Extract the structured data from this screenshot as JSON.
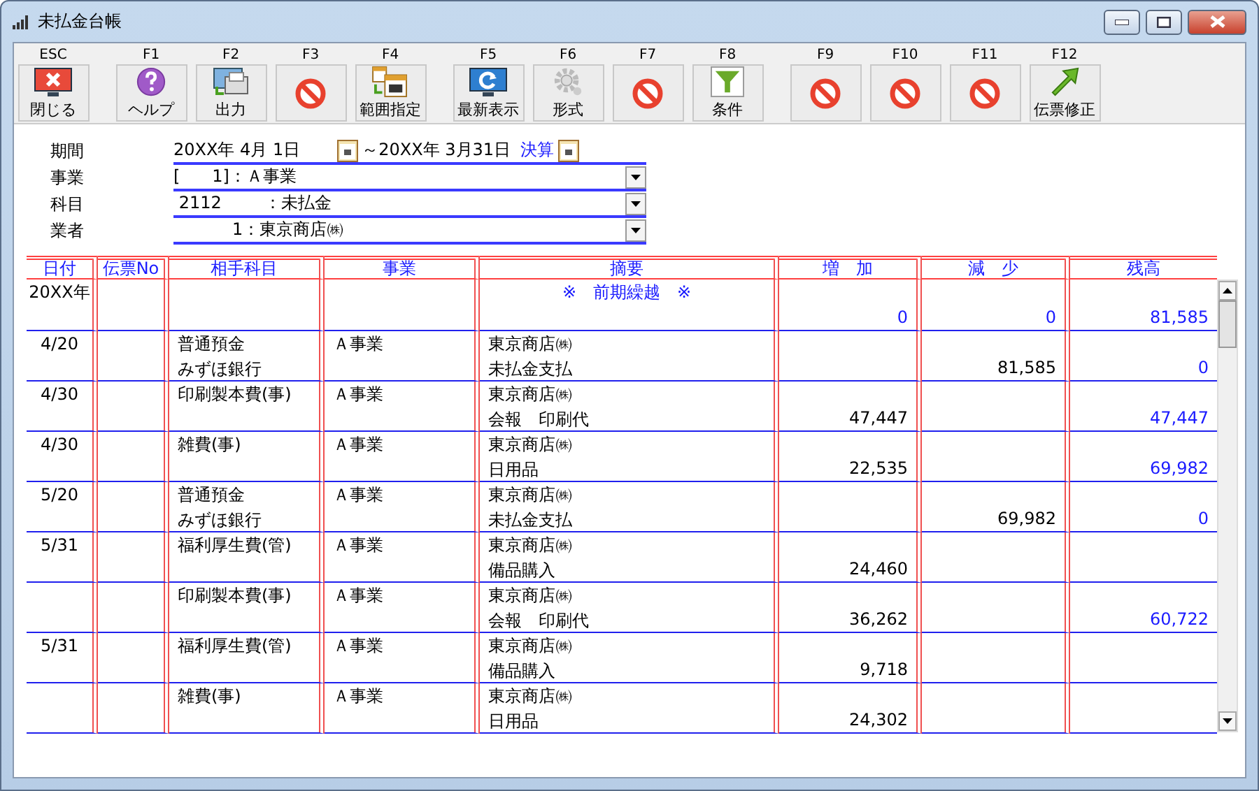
{
  "window": {
    "title": "未払金台帳"
  },
  "toolbar": [
    [
      {
        "key": "ESC",
        "kind": "close",
        "label": "閉じる"
      }
    ],
    [
      {
        "key": "F1",
        "kind": "help",
        "label": "ヘルプ"
      },
      {
        "key": "F2",
        "kind": "output",
        "label": "出力"
      },
      {
        "key": "F3",
        "kind": "none"
      },
      {
        "key": "F4",
        "kind": "calendar",
        "label": "範囲指定"
      }
    ],
    [
      {
        "key": "F5",
        "kind": "refresh",
        "label": "最新表示"
      },
      {
        "key": "F6",
        "kind": "gear",
        "label": "形式"
      },
      {
        "key": "F7",
        "kind": "none"
      },
      {
        "key": "F8",
        "kind": "filter",
        "label": "条件"
      }
    ],
    [
      {
        "key": "F9",
        "kind": "none"
      },
      {
        "key": "F10",
        "kind": "none"
      },
      {
        "key": "F11",
        "kind": "none"
      },
      {
        "key": "F12",
        "kind": "arrow",
        "label": "伝票修正"
      }
    ]
  ],
  "period": {
    "label": "期間",
    "from": "20XX年 4月 1日",
    "to": "～20XX年 3月31日",
    "link": "決算"
  },
  "fields": [
    {
      "label": "事業",
      "value": "[      1]：Ａ事業"
    },
    {
      "label": "科目",
      "value": " 2112        ：未払金"
    },
    {
      "label": "業者",
      "value": "           1：東京商店㈱"
    }
  ],
  "table": {
    "columns": [
      "日付",
      "伝票No",
      "相手科目",
      "事業",
      "摘要",
      "増　加",
      "減　少",
      "残高"
    ],
    "rows": [
      {
        "kind": "carry",
        "date": "20XX年",
        "memo": [
          "※　前期繰越　※"
        ],
        "increase": "0",
        "decrease": "0",
        "balance": "81,585"
      },
      {
        "kind": "entry",
        "date": "4/20",
        "account": [
          "普通預金",
          "みずほ銀行"
        ],
        "business": "Ａ事業",
        "memo": [
          "東京商店㈱",
          "未払金支払"
        ],
        "decrease": "81,585",
        "balance": "0"
      },
      {
        "kind": "entry",
        "date": "4/30",
        "account": [
          "印刷製本費(事)"
        ],
        "business": "Ａ事業",
        "memo": [
          "東京商店㈱",
          "会報　印刷代"
        ],
        "increase": "47,447",
        "balance": "47,447"
      },
      {
        "kind": "entry",
        "date": "4/30",
        "account": [
          "雑費(事)"
        ],
        "business": "Ａ事業",
        "memo": [
          "東京商店㈱",
          "日用品"
        ],
        "increase": "22,535",
        "balance": "69,982"
      },
      {
        "kind": "entry",
        "date": "5/20",
        "account": [
          "普通預金",
          "みずほ銀行"
        ],
        "business": "Ａ事業",
        "memo": [
          "東京商店㈱",
          "未払金支払"
        ],
        "decrease": "69,982",
        "balance": "0"
      },
      {
        "kind": "entry",
        "date": "5/31",
        "account": [
          "福利厚生費(管)"
        ],
        "business": "Ａ事業",
        "memo": [
          "東京商店㈱",
          "備品購入"
        ],
        "increase": "24,460"
      },
      {
        "kind": "entry",
        "account": [
          "印刷製本費(事)"
        ],
        "business": "Ａ事業",
        "memo": [
          "東京商店㈱",
          "会報　印刷代"
        ],
        "increase": "36,262",
        "balance": "60,722"
      },
      {
        "kind": "entry",
        "date": "5/31",
        "account": [
          "福利厚生費(管)"
        ],
        "business": "Ａ事業",
        "memo": [
          "東京商店㈱",
          "備品購入"
        ],
        "increase": "9,718"
      },
      {
        "kind": "entry",
        "account": [
          "雑費(事)"
        ],
        "business": "Ａ事業",
        "memo": [
          "東京商店㈱",
          "日用品"
        ],
        "increase": "24,302"
      }
    ]
  }
}
